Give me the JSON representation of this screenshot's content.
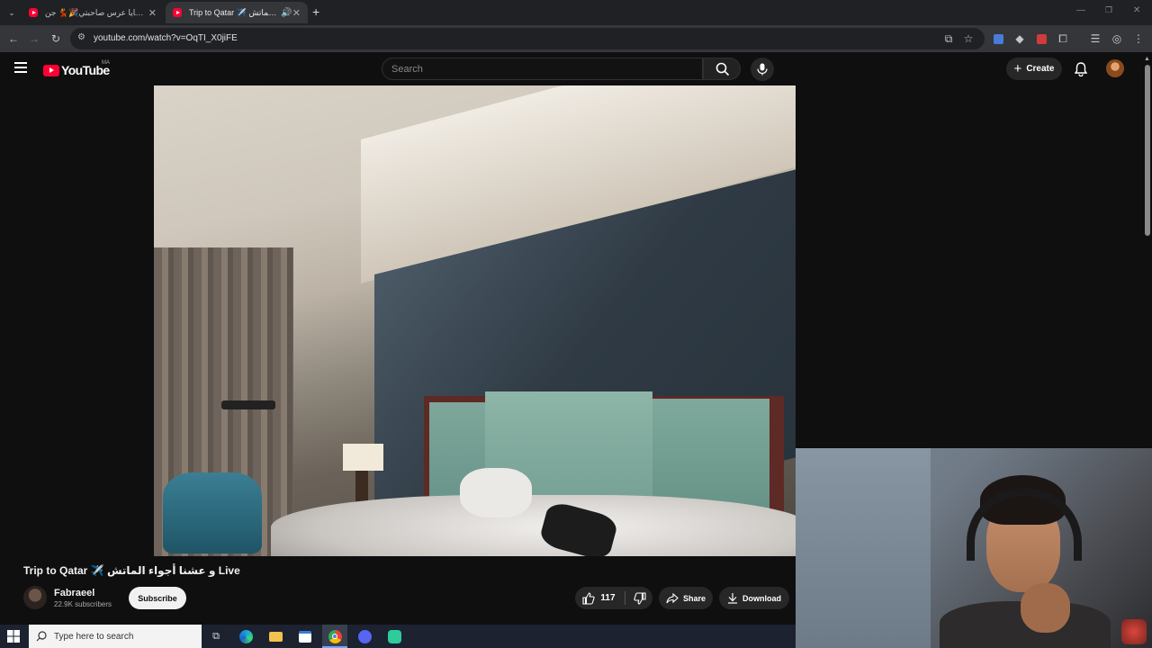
{
  "browser": {
    "tabs": [
      {
        "title": "دوزو معايا عرس صاحبتي🎉💃 جن..",
        "active": false
      },
      {
        "title": "Trip to Qatar ✈️ و عشنا أجواء الماتش",
        "active": true
      }
    ],
    "new_tab": "+",
    "url": "youtube.com/watch?v=OqTI_X0jiFE"
  },
  "youtube": {
    "logo_text": "YouTube",
    "country_code": "MA",
    "search_placeholder": "Search",
    "create_label": "Create"
  },
  "video": {
    "title": "Trip to Qatar ✈️ و عشنا أجواء الماتش Live",
    "channel_name": "Fabraeel",
    "subscribers": "22.9K subscribers",
    "subscribe_label": "Subscribe",
    "likes": "117",
    "share_label": "Share",
    "download_label": "Download"
  },
  "taskbar": {
    "search_placeholder": "Type here to search"
  },
  "colors": {
    "youtube_red": "#ff0033",
    "background": "#0f0f0f",
    "button_bg": "#272727"
  },
  "icons": [
    "menu-icon",
    "search-icon",
    "mic-icon",
    "bell-icon",
    "like-icon",
    "dislike-icon",
    "share-icon",
    "download-icon",
    "windows-start-icon",
    "chrome-icon",
    "edge-icon",
    "folder-icon"
  ]
}
